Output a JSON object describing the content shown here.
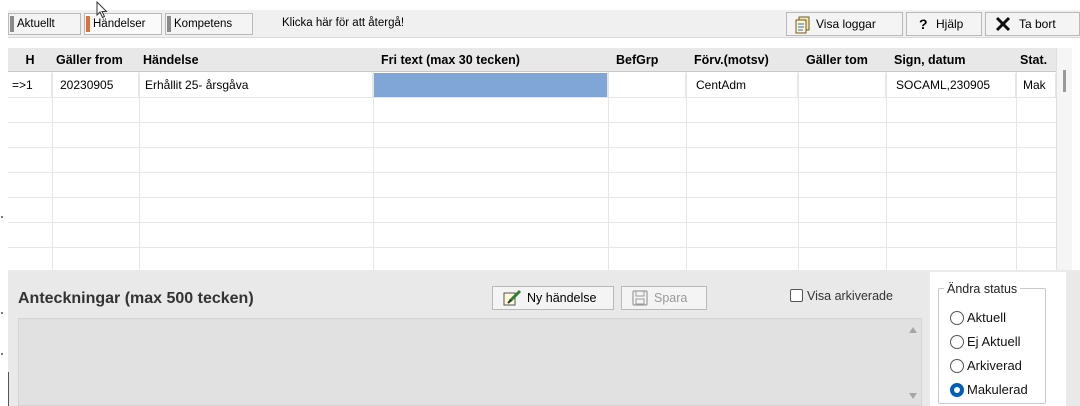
{
  "toolbar": {
    "tabs": [
      {
        "label": "Aktuellt",
        "active": false
      },
      {
        "label": "Händelser",
        "active": true
      },
      {
        "label": "Kompetens",
        "active": false
      }
    ],
    "back_link": "Klicka här för att återgå!",
    "buttons": {
      "visa_loggar": "Visa loggar",
      "hjalp": "Hjälp",
      "ta_bort": "Ta bort"
    }
  },
  "grid": {
    "columns": [
      "H",
      "Gäller from",
      "Händelse",
      "Fri text (max 30 tecken)",
      "BefGrp",
      "Förv.(motsv)",
      "Gäller tom",
      "Sign, datum",
      "Stat."
    ],
    "rows": [
      {
        "h": "=>1",
        "galler_from": "20230905",
        "handelse": "Erhållit 25- årsgåva",
        "fri_text": "",
        "befgrp": "",
        "forv": "CentAdm",
        "galler_tom": "",
        "sign": "SOCAML,230905",
        "stat": "Mak"
      }
    ],
    "selection_color": "#7fa6d6"
  },
  "notes": {
    "title": "Anteckningar (max 500 tecken)",
    "new_event_button": "Ny händelse",
    "save_button": "Spara",
    "show_archived_label": "Visa arkiverade",
    "show_archived_checked": false
  },
  "status": {
    "legend": "Ändra status",
    "options": [
      {
        "label": "Aktuell",
        "checked": false
      },
      {
        "label": "Ej Aktuell",
        "checked": false
      },
      {
        "label": "Arkiverad",
        "checked": false
      },
      {
        "label": "Makulerad",
        "checked": true
      }
    ],
    "accent": "#005fb8"
  },
  "icons": [
    "tab-marker-icon",
    "log-icon",
    "help-icon",
    "delete-x-icon",
    "new-event-icon",
    "save-disk-icon",
    "scroll-up-icon",
    "scroll-down-icon",
    "cursor-icon"
  ]
}
